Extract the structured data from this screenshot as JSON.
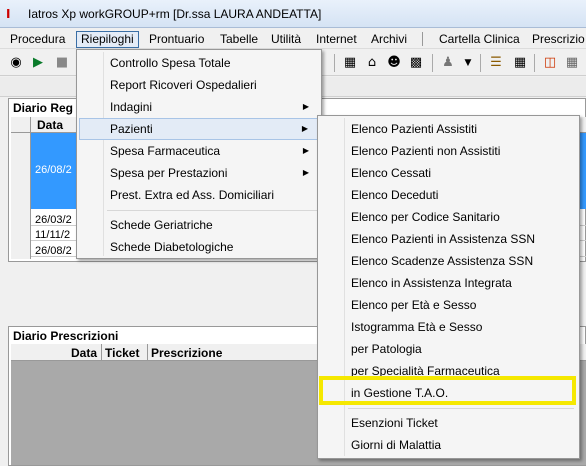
{
  "window": {
    "title": "Iatros Xp workGROUP+rm [Dr.ssa LAURA ANDEATTA]",
    "app_icon_glyph": "I"
  },
  "menubar": {
    "items": [
      "Procedura",
      "Riepiloghi",
      "Prontuario",
      "Tabelle",
      "Utilità",
      "Internet",
      "Archivi",
      "Cartella Clinica",
      "Prescrizio"
    ]
  },
  "toolbar": {
    "icons": [
      "binoculars-icon",
      "forward-star-icon",
      "stop-icon",
      "calculator-icon",
      "house-icon",
      "person-icon",
      "card-icon",
      "user-icon",
      "chevron-down-icon",
      "book-icon",
      "calendar-icon",
      "document-icon",
      "grid-icon"
    ]
  },
  "diario_registrazioni": {
    "title": "Diario Reg",
    "column_date": "Data",
    "selected_date": "26/08/2",
    "rows": [
      "26/03/2",
      "11/11/2",
      "26/08/2"
    ]
  },
  "diario_prescrizioni": {
    "title": "Diario Prescrizioni",
    "columns": [
      "Data",
      "Ticket",
      "Prescrizione"
    ]
  },
  "menu_riepiloghi": {
    "items": [
      {
        "label": "Controllo Spesa Totale",
        "submenu": false
      },
      {
        "label": "Report Ricoveri Ospedalieri",
        "submenu": false
      },
      {
        "label": "Indagini",
        "submenu": true
      },
      {
        "label": "Pazienti",
        "submenu": true
      },
      {
        "label": "Spesa Farmaceutica",
        "submenu": true
      },
      {
        "label": "Spesa per Prestazioni",
        "submenu": true
      },
      {
        "label": "Prest. Extra ed Ass. Domiciliari",
        "submenu": false
      },
      {
        "label": "Schede Geriatriche",
        "submenu": false
      },
      {
        "label": "Schede Diabetologiche",
        "submenu": false
      }
    ]
  },
  "menu_pazienti": {
    "items": [
      "Elenco Pazienti Assistiti",
      "Elenco Pazienti non Assistiti",
      "Elenco Cessati",
      "Elenco Deceduti",
      "Elenco per Codice Sanitario",
      "Elenco Pazienti in Assistenza SSN",
      "Elenco Scadenze Assistenza SSN",
      "Elenco in Assistenza Integrata",
      "Elenco per Età e Sesso",
      "Istogramma Età e Sesso",
      "per Patologia",
      "per Specialità Farmaceutica",
      "in Gestione T.A.O.",
      "Esenzioni Ticket",
      "Giorni di Malattia"
    ],
    "highlighted_item": "in Gestione T.A.O.",
    "highlight_color": "#f5e800"
  },
  "colors": {
    "selection_blue": "#3399ff",
    "menu_highlight": "#e3ebf6"
  }
}
